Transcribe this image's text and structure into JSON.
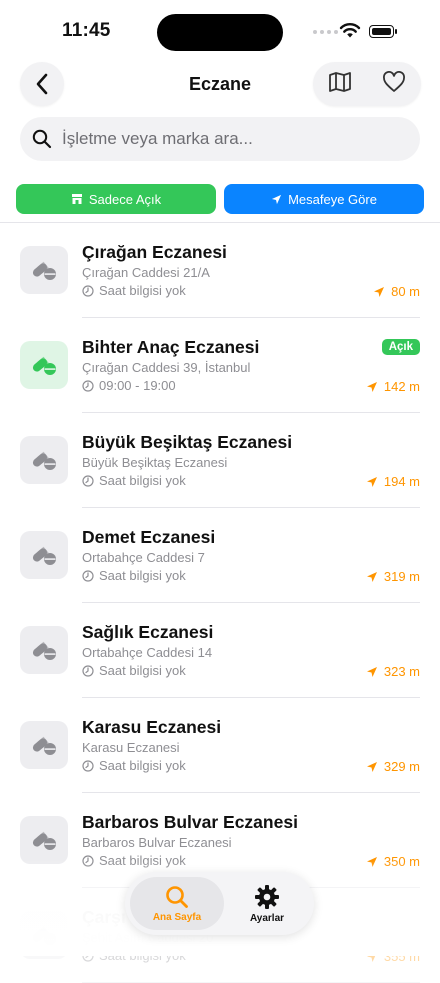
{
  "status": {
    "time": "11:45"
  },
  "header": {
    "title": "Eczane"
  },
  "search": {
    "placeholder": "İşletme veya marka ara..."
  },
  "filters": {
    "open_only": "Sadece Açık",
    "by_distance": "Mesafeye Göre"
  },
  "colors": {
    "green": "#34c759",
    "blue": "#0a84ff",
    "orange": "#ff9500",
    "gray_text": "#8e8e93"
  },
  "pharmacies": [
    {
      "name": "Çırağan Eczanesi",
      "address": "Çırağan Caddesi 21/A",
      "hours": "Saat bilgisi yok",
      "distance": "80 m",
      "open": false,
      "badge": ""
    },
    {
      "name": "Bihter Anaç Eczanesi",
      "address": "Çırağan Caddesi 39, İstanbul",
      "hours": "09:00 - 19:00",
      "distance": "142 m",
      "open": true,
      "badge": "Açık"
    },
    {
      "name": "Büyük Beşiktaş Eczanesi",
      "address": "Büyük Beşiktaş Eczanesi",
      "hours": "Saat bilgisi yok",
      "distance": "194 m",
      "open": false,
      "badge": ""
    },
    {
      "name": "Demet Eczanesi",
      "address": "Ortabahçe Caddesi 7",
      "hours": "Saat bilgisi yok",
      "distance": "319 m",
      "open": false,
      "badge": ""
    },
    {
      "name": "Sağlık Eczanesi",
      "address": "Ortabahçe Caddesi 14",
      "hours": "Saat bilgisi yok",
      "distance": "323 m",
      "open": false,
      "badge": ""
    },
    {
      "name": "Karasu Eczanesi",
      "address": "Karasu Eczanesi",
      "hours": "Saat bilgisi yok",
      "distance": "329 m",
      "open": false,
      "badge": ""
    },
    {
      "name": "Barbaros Bulvar Eczanesi",
      "address": "Barbaros Bulvar Eczanesi",
      "hours": "Saat bilgisi yok",
      "distance": "350 m",
      "open": false,
      "badge": ""
    },
    {
      "name": "Çarşı Eczanesi",
      "address": "Şehit Asım Caddesi 20",
      "hours": "Saat bilgisi yok",
      "distance": "355 m",
      "open": false,
      "badge": ""
    }
  ],
  "tabbar": {
    "home": "Ana Sayfa",
    "settings": "Ayarlar"
  }
}
